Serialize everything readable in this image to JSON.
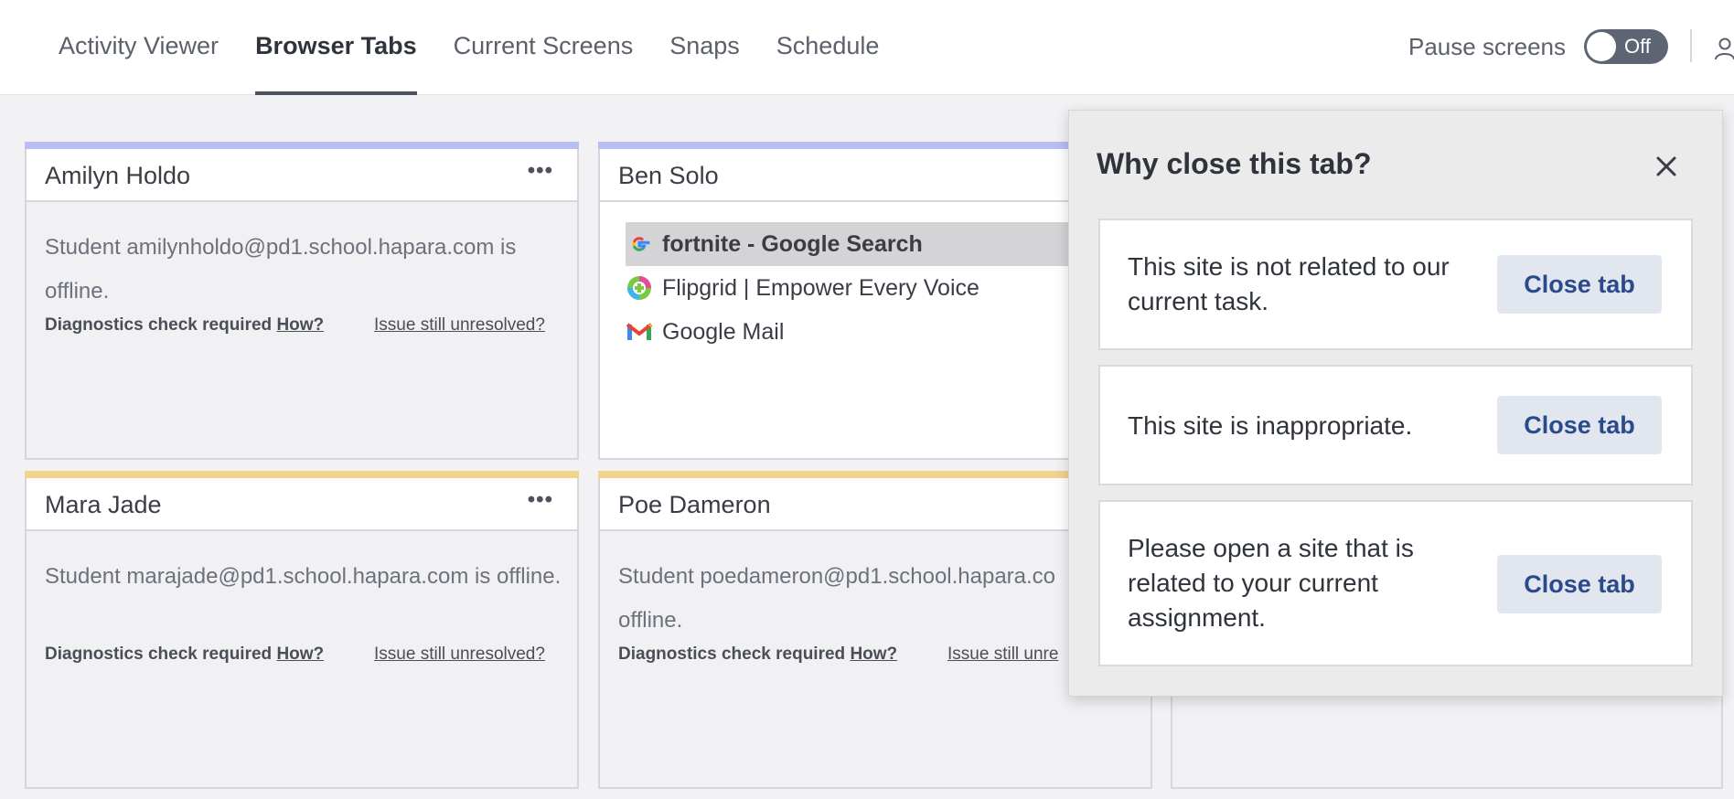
{
  "nav": {
    "tabs": [
      {
        "label": "Activity Viewer"
      },
      {
        "label": "Browser Tabs"
      },
      {
        "label": "Current Screens"
      },
      {
        "label": "Snaps"
      },
      {
        "label": "Schedule"
      }
    ],
    "active_tab": "Browser Tabs",
    "pause_label": "Pause screens",
    "toggle_state": "Off",
    "user_icon": "user-icon"
  },
  "colors": {
    "bar_blue": "#b8bdf3",
    "bar_yellow": "#f2d38c",
    "accent_button_text": "#2b4a8c"
  },
  "cards": [
    {
      "name": "Amilyn Holdo",
      "status": "offline",
      "message": "Student amilynholdo@pd1.school.hapara.com is offline.",
      "diag_label": "Diagnostics check required",
      "how_link": "How?",
      "issue_link": "Issue still unresolved?"
    },
    {
      "name": "Ben Solo",
      "status": "online",
      "tabs": [
        {
          "title": "fortnite - Google Search",
          "icon": "google-icon",
          "selected": true
        },
        {
          "title": "Flipgrid | Empower Every Voice",
          "icon": "flipgrid-icon",
          "selected": false
        },
        {
          "title": "Google Mail",
          "icon": "gmail-icon",
          "selected": false
        }
      ]
    },
    {
      "name": "Mara Jade",
      "status": "offline",
      "message": "Student marajade@pd1.school.hapara.com is offline.",
      "diag_label": "Diagnostics check required",
      "how_link": "How?",
      "issue_link": "Issue still unresolved?"
    },
    {
      "name": "Poe Dameron",
      "status": "offline",
      "message": "Student poedameron@pd1.school.hapara.co",
      "message_2": "offline.",
      "diag_label": "Diagnostics check required",
      "how_link": "How?",
      "issue_link": "Issue still unre"
    }
  ],
  "modal": {
    "title": "Why close this tab?",
    "close_icon": "close-icon",
    "reasons": [
      {
        "text": "This site is not related to our current task.",
        "button": "Close tab"
      },
      {
        "text": "This site is inappropriate.",
        "button": "Close tab"
      },
      {
        "text": "Please open a site that is related to your current assignment.",
        "button": "Close tab"
      }
    ]
  }
}
